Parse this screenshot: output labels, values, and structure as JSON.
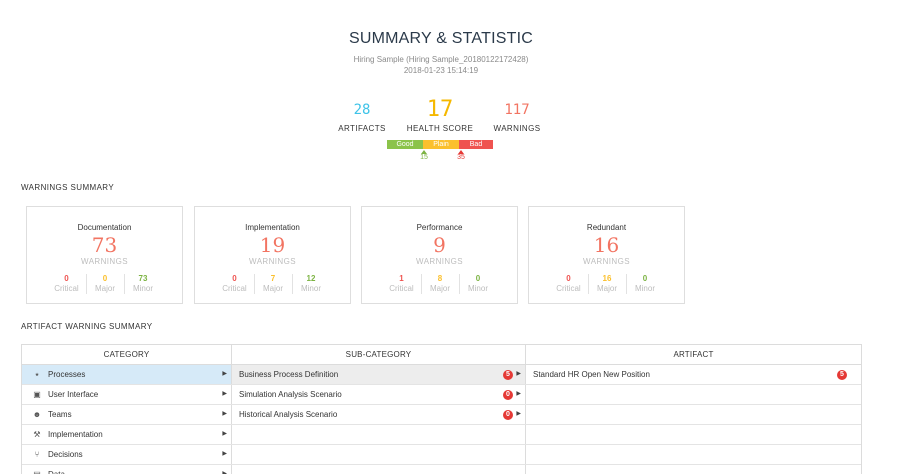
{
  "header": {
    "title": "SUMMARY & STATISTIC",
    "project": "Hiring Sample (Hiring Sample_20180122172428)",
    "datetime": "2018-01-23 15:14:19"
  },
  "stats": {
    "artifacts": {
      "value": "28",
      "label": "ARTIFACTS"
    },
    "health": {
      "value": "17",
      "label": "HEALTH SCORE"
    },
    "warnings": {
      "value": "117",
      "label": "WARNINGS"
    }
  },
  "health_bar": {
    "segments": [
      "Good",
      "Plain",
      "Bad"
    ],
    "marker_good": "15",
    "marker_bad": "35",
    "colors": {
      "good": "#8bc34a",
      "plain": "#fbc02d",
      "bad": "#ef5350"
    }
  },
  "warnings_summary": {
    "title": "WARNINGS SUMMARY",
    "warnings_label": "WARNINGS",
    "labels": {
      "critical": "Critical",
      "major": "Major",
      "minor": "Minor"
    },
    "cards": [
      {
        "title": "Documentation",
        "total": "73",
        "critical": "0",
        "major": "0",
        "minor": "73"
      },
      {
        "title": "Implementation",
        "total": "19",
        "critical": "0",
        "major": "7",
        "minor": "12"
      },
      {
        "title": "Performance",
        "total": "9",
        "critical": "1",
        "major": "8",
        "minor": "0"
      },
      {
        "title": "Redundant",
        "total": "16",
        "critical": "0",
        "major": "16",
        "minor": "0"
      }
    ]
  },
  "artifact_summary": {
    "title": "ARTIFACT WARNING SUMMARY",
    "columns": [
      "CATEGORY",
      "SUB-CATEGORY",
      "ARTIFACT"
    ],
    "categories": [
      {
        "label": "Processes",
        "icon": "share-icon",
        "selected": true
      },
      {
        "label": "User Interface",
        "icon": "ui-icon"
      },
      {
        "label": "Teams",
        "icon": "team-icon"
      },
      {
        "label": "Implementation",
        "icon": "tools-icon"
      },
      {
        "label": "Decisions",
        "icon": "decision-icon"
      },
      {
        "label": "Data",
        "icon": "data-icon"
      }
    ],
    "subcategories": [
      {
        "label": "Business Process Definition",
        "count": "5"
      },
      {
        "label": "Simulation Analysis Scenario",
        "count": "0"
      },
      {
        "label": "Historical Analysis Scenario",
        "count": "0"
      }
    ],
    "artifacts": [
      {
        "label": "Standard HR Open New Position",
        "count": "5"
      }
    ]
  }
}
